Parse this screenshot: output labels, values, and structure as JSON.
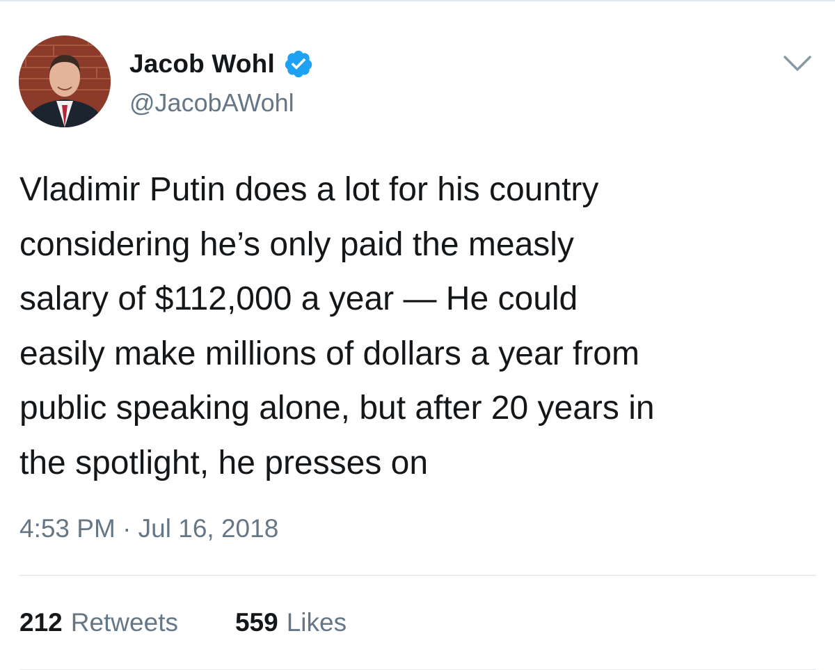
{
  "author": {
    "name": "Jacob Wohl",
    "handle": "@JacobAWohl",
    "verified": true
  },
  "tweet": {
    "text": "Vladimir Putin does a lot for his country\nconsidering he’s only paid the measly\nsalary of $112,000 a year — He could\neasily make millions of dollars a year from\npublic speaking alone, but after 20 years in\nthe spotlight, he presses on",
    "timestamp": "4:53 PM · Jul 16, 2018"
  },
  "stats": {
    "retweets_count": "212",
    "retweets_label": "Retweets",
    "likes_count": "559",
    "likes_label": "Likes"
  },
  "icons": {
    "verified": "verified-badge-icon",
    "menu": "chevron-down-icon"
  },
  "colors": {
    "verified_blue": "#1da1f2",
    "secondary_text": "#657786",
    "primary_text": "#14171a"
  }
}
